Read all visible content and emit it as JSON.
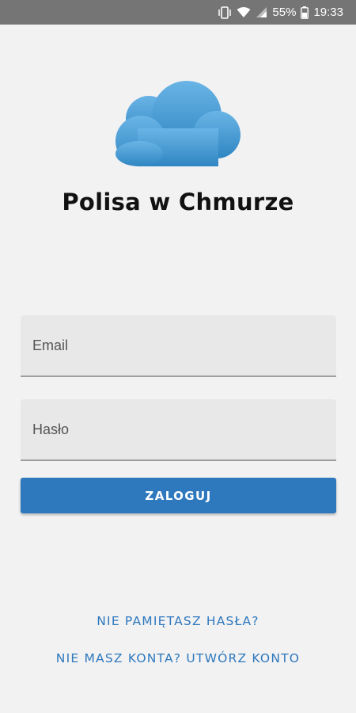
{
  "status_bar": {
    "battery_percent": "55%",
    "time": "19:33",
    "icons": [
      "vibrate-icon",
      "wifi-icon",
      "signal-icon",
      "battery-icon"
    ]
  },
  "app": {
    "title": "Polisa w Chmurze",
    "logo_icon": "cloud-icon",
    "logo_color_top": "#6ab4e6",
    "logo_color_bottom": "#2f86c2"
  },
  "form": {
    "email_placeholder": "Email",
    "email_value": "",
    "password_placeholder": "Hasło",
    "password_value": "",
    "login_label": "ZALOGUJ"
  },
  "links": {
    "forgot_password": "NIE PAMIĘTASZ HASŁA?",
    "register": "NIE MASZ KONTA? UTWÓRZ KONTO"
  },
  "colors": {
    "accent": "#2e78be",
    "background": "#f2f2f2",
    "status_bar": "#757575"
  }
}
